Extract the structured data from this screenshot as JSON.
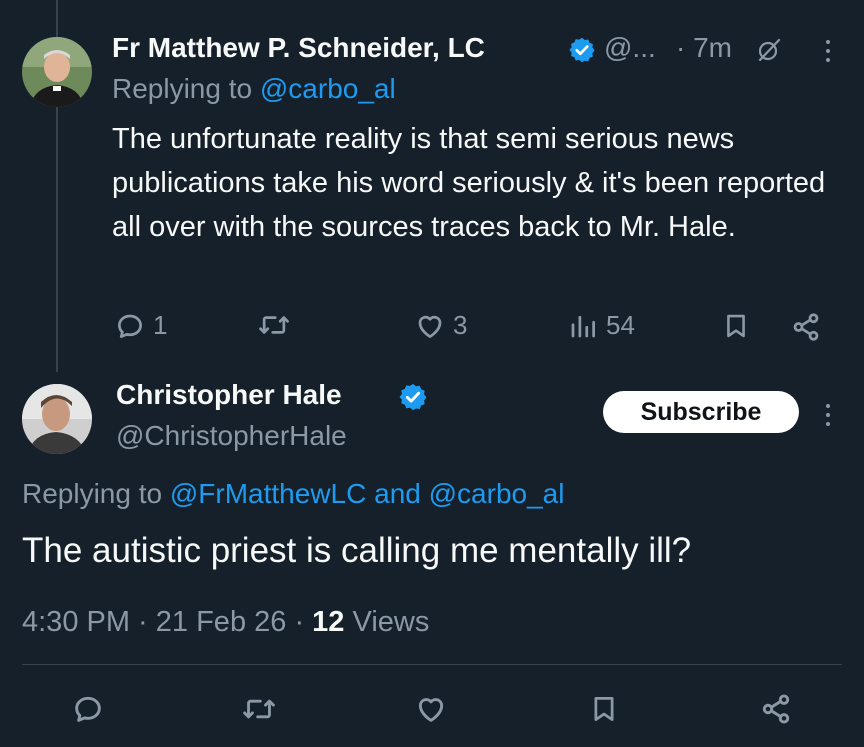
{
  "reply_tweet": {
    "author_name": "Fr Matthew P. Schneider, LC",
    "handle_truncated": "@...",
    "time": "· 7m",
    "replying_prefix": "Replying to ",
    "replying_to": "@carbo_al",
    "text": "The unfortunate reality is that semi serious news publications take his word seriously & it's been reported all over with the sources traces back to Mr. Hale.",
    "replies": "1",
    "retweets": "",
    "likes": "3",
    "views": "54"
  },
  "main_tweet": {
    "author_name": "Christopher Hale",
    "handle": "@ChristopherHale",
    "subscribe_label": "Subscribe",
    "replying_prefix": "Replying to ",
    "replying_to_1": "@FrMatthewLC",
    "replying_and": " and ",
    "replying_to_2": "@carbo_al",
    "text": "The autistic priest is calling me mentally ill?",
    "time": "4:30 PM",
    "date_sep": " · ",
    "date": "21 Feb 26",
    "views_sep": " · ",
    "views_count": "12",
    "views_label": " Views"
  },
  "colors": {
    "background": "#15202b",
    "text": "#f7f9f9",
    "muted": "#8b98a5",
    "accent": "#1d9bf0",
    "border": "#38444d"
  },
  "icons": [
    "verified-badge-icon",
    "grok-slash-icon",
    "more-icon",
    "reply-icon",
    "retweet-icon",
    "like-icon",
    "views-icon",
    "bookmark-icon",
    "share-icon"
  ]
}
